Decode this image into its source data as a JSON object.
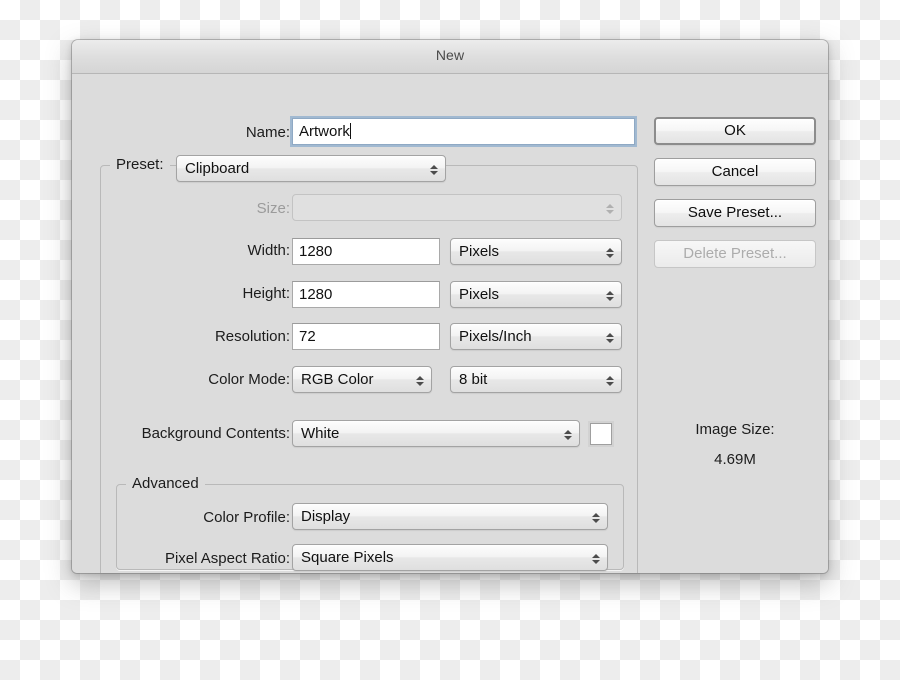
{
  "window": {
    "title": "New"
  },
  "form": {
    "name": {
      "label": "Name:",
      "value": "Artwork"
    },
    "preset": {
      "label": "Preset:",
      "value": "Clipboard"
    },
    "size": {
      "label": "Size:",
      "value": ""
    },
    "width": {
      "label": "Width:",
      "value": "1280",
      "unit": "Pixels"
    },
    "height": {
      "label": "Height:",
      "value": "1280",
      "unit": "Pixels"
    },
    "resolution": {
      "label": "Resolution:",
      "value": "72",
      "unit": "Pixels/Inch"
    },
    "color_mode": {
      "label": "Color Mode:",
      "value": "RGB Color",
      "depth": "8 bit"
    },
    "background_contents": {
      "label": "Background Contents:",
      "value": "White",
      "swatch_color": "#ffffff"
    }
  },
  "advanced": {
    "legend": "Advanced",
    "color_profile": {
      "label": "Color Profile:",
      "value": "Display"
    },
    "pixel_aspect_ratio": {
      "label": "Pixel Aspect Ratio:",
      "value": "Square Pixels"
    }
  },
  "buttons": {
    "ok": "OK",
    "cancel": "Cancel",
    "save_preset": "Save Preset...",
    "delete_preset": "Delete Preset..."
  },
  "image_size": {
    "label": "Image Size:",
    "value": "4.69M"
  }
}
